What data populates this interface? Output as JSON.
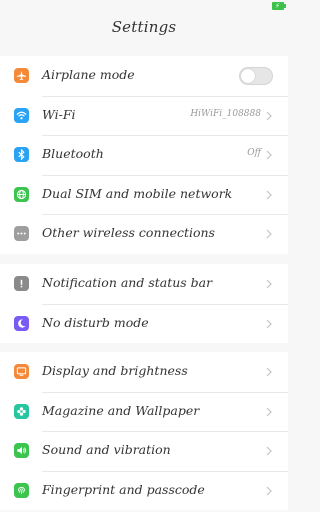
{
  "header": {
    "title": "Settings"
  },
  "status_bar": {
    "battery_icon": "battery-charging-icon",
    "battery_color": "#3cc24a"
  },
  "groups": [
    {
      "items": [
        {
          "label": "Airplane mode",
          "icon": "airplane-icon",
          "color": "#f5893a",
          "control": "toggle",
          "toggle_on": false
        },
        {
          "label": "Wi-Fi",
          "icon": "wifi-icon",
          "color": "#2aa3f5",
          "value": "HiWiFi_108888",
          "control": "chevron"
        },
        {
          "label": "Bluetooth",
          "icon": "bluetooth-icon",
          "color": "#2aa3f5",
          "value": "Off",
          "control": "chevron"
        },
        {
          "label": "Dual SIM and mobile network",
          "icon": "globe-icon",
          "color": "#3bc44e",
          "control": "chevron"
        },
        {
          "label": "Other wireless connections",
          "icon": "more-icon",
          "color": "#9e9e9e",
          "control": "chevron"
        }
      ]
    },
    {
      "items": [
        {
          "label": "Notification and status bar",
          "icon": "notification-icon",
          "color": "#8a8a8a",
          "control": "chevron"
        },
        {
          "label": "No disturb mode",
          "icon": "moon-icon",
          "color": "#7a5cf5",
          "control": "chevron"
        }
      ]
    },
    {
      "items": [
        {
          "label": "Display and brightness",
          "icon": "display-icon",
          "color": "#f5893a",
          "control": "chevron"
        },
        {
          "label": "Magazine and Wallpaper",
          "icon": "flower-icon",
          "color": "#25c6a0",
          "control": "chevron"
        },
        {
          "label": "Sound and vibration",
          "icon": "speaker-icon",
          "color": "#3bc44e",
          "control": "chevron"
        },
        {
          "label": "Fingerprint and passcode",
          "icon": "fingerprint-icon",
          "color": "#3bc44e",
          "control": "chevron"
        }
      ]
    }
  ]
}
